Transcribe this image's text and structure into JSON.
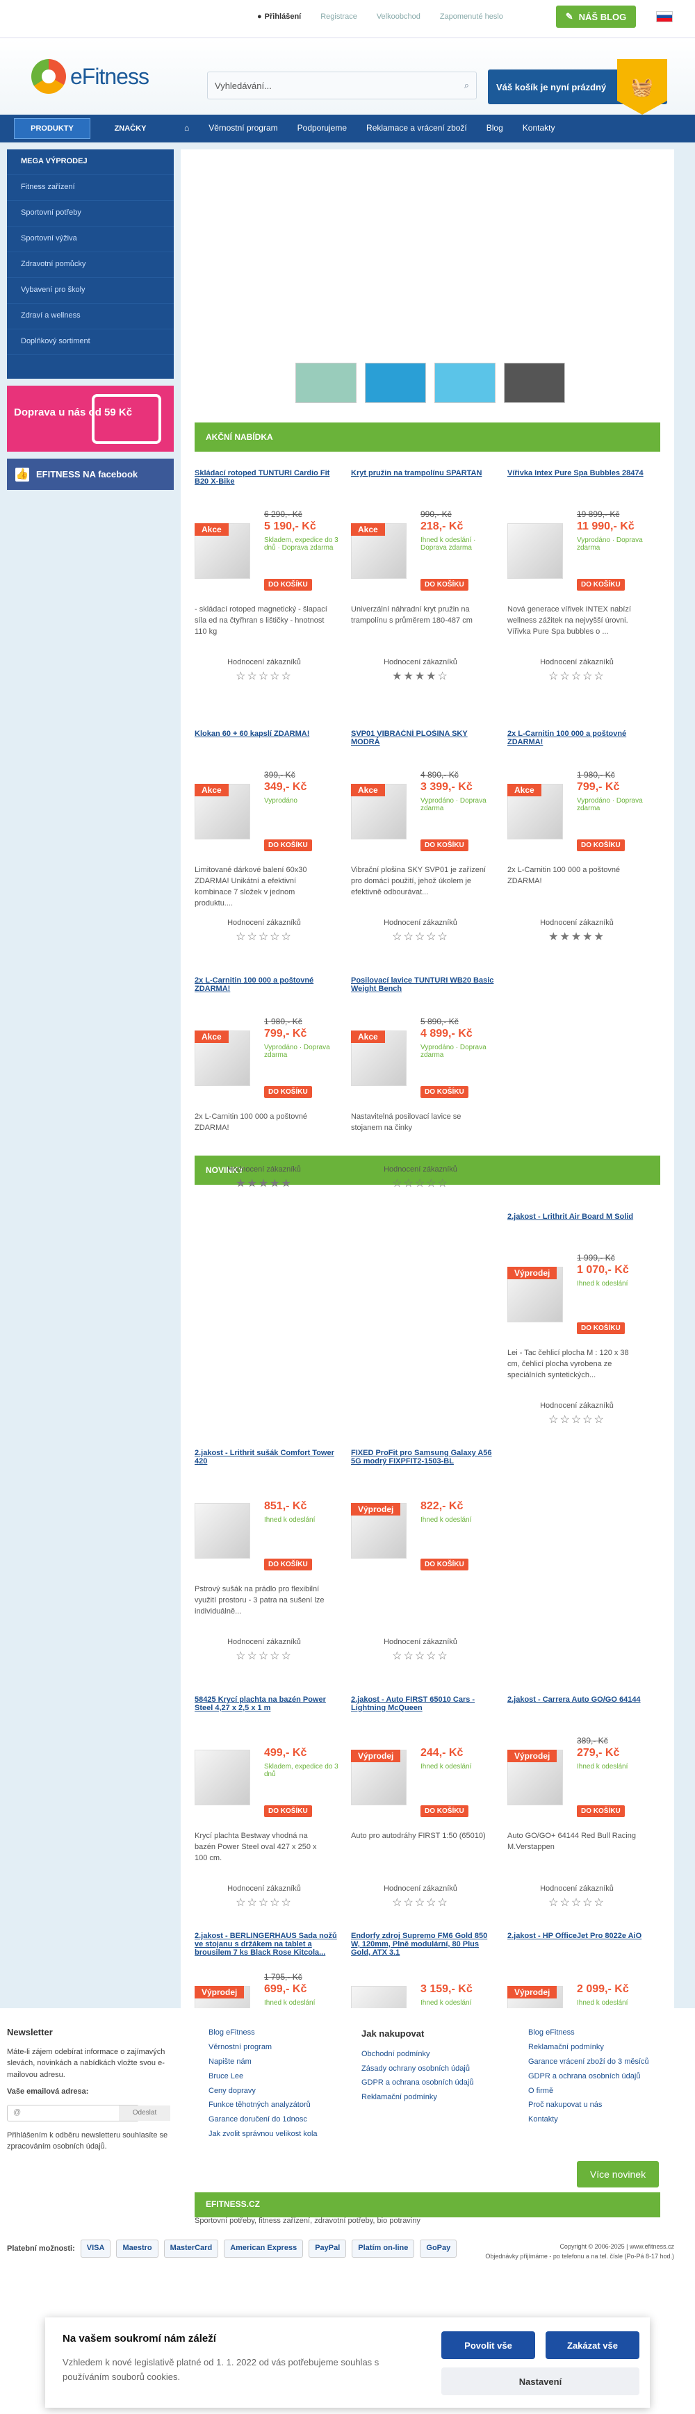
{
  "top": {
    "login": "Přihlášení",
    "register": "Registrace",
    "wholesale": "Velkoobchod",
    "forgot": "Zapomenuté heslo",
    "blog": "NÁŠ BLOG"
  },
  "header": {
    "logo": "eFitness",
    "search_placeholder": "Vyhledávání...",
    "cart": "Váš košík je nyní prázdný"
  },
  "nav": {
    "products": "PRODUKTY",
    "brands": "ZNAČKY",
    "links": [
      "Věrnostní program",
      "Podporujeme",
      "Reklamace a vrácení zboží",
      "Blog",
      "Kontakty"
    ]
  },
  "sidebar": [
    "MEGA VÝPRODEJ",
    "Fitness zařízení",
    "Sportovní potřeby",
    "Sportovní výživa",
    "Zdravotní pomůcky",
    "Vybavení pro školy",
    "Zdraví a wellness",
    "Doplňkový sortiment"
  ],
  "doprava": "Doprava u nás od 59 Kč",
  "facebook": "EFITNESS NA facebook",
  "sections": {
    "akce": "AKČNÍ NABÍDKA",
    "novinky": "NOVINKY"
  },
  "rating_label": "Hodnocení zákazníků",
  "buy_label": "DO KOŠÍKU",
  "products": [
    {
      "title": "Skládací rotoped TUNTURI Cardio Fit B20 X-Bike",
      "tag": "Akce",
      "old": "6 290,- Kč",
      "new": "5 190,- Kč",
      "avail": "Skladem, expedice do 3 dnů · Doprava zdarma",
      "desc": "- skládací rotoped magnetický - šlapací síla ed na čtyřhran s lištičky - hnotnost 110 kg",
      "stars": "☆☆☆☆☆"
    },
    {
      "title": "Kryt pružin na trampolínu SPARTAN",
      "tag": "Akce",
      "old": "990,- Kč",
      "new": "218,- Kč",
      "avail": "Ihned k odeslání · Doprava zdarma",
      "desc": "Univerzální náhradní kryt pružin na trampolínu s průměrem 180-487 cm",
      "stars": "★★★★☆"
    },
    {
      "title": "Vířivka Intex Pure Spa Bubbles 28474",
      "tag": "",
      "old": "19 899,- Kč",
      "new": "11 990,- Kč",
      "avail": "Vyprodáno · Doprava zdarma",
      "desc": "Nová generace vířivek INTEX nabízí wellness zážitek na nejvyšší úrovni. Vířivka Pure Spa bubbles o ...",
      "stars": "☆☆☆☆☆"
    },
    {
      "title": "Klokan 60 + 60 kapslí ZDARMA!",
      "tag": "Akce",
      "old": "399,- Kč",
      "new": "349,- Kč",
      "avail": "Vyprodáno",
      "desc": "Limitované dárkové balení 60x30 ZDARMA! Unikátní a efektivní kombinace 7 složek v jednom produktu....",
      "stars": "☆☆☆☆☆"
    },
    {
      "title": "SVP01 VIBRAČNÍ PLOŠINA SKY MODRÁ",
      "tag": "Akce",
      "old": "4 890,- Kč",
      "new": "3 399,- Kč",
      "avail": "Vyprodáno · Doprava zdarma",
      "desc": "Vibrační plošina SKY SVP01 je zařízení pro domácí použití, jehož úkolem je efektivně odbourávat...",
      "stars": "☆☆☆☆☆"
    },
    {
      "title": "2x L-Carnitin 100 000 a poštovné ZDARMA!",
      "tag": "Akce",
      "old": "1 980,- Kč",
      "new": "799,- Kč",
      "avail": "Vyprodáno · Doprava zdarma",
      "desc": "2x L-Carnitin 100 000 a poštovné ZDARMA!",
      "stars": "★★★★★"
    },
    {
      "title": "2x L-Carnitin 100 000 a poštovné ZDARMA!",
      "tag": "Akce",
      "old": "1 980,- Kč",
      "new": "799,- Kč",
      "avail": "Vyprodáno · Doprava zdarma",
      "desc": "2x L-Carnitin 100 000 a poštovné ZDARMA!",
      "stars": "★★★★★"
    },
    {
      "title": "Posilovací lavice TUNTURI WB20 Basic Weight Bench",
      "tag": "Akce",
      "old": "5 890,- Kč",
      "new": "4 899,- Kč",
      "avail": "Vyprodáno · Doprava zdarma",
      "desc": "Nastavitelná posilovací lavice se stojanem na činky",
      "stars": "☆☆☆☆☆"
    },
    {
      "title": "2.jakost - Lrithrit Air Board M Solid",
      "tag": "Výprodej",
      "old": "1 999,- Kč",
      "new": "1 070,- Kč",
      "avail": "Ihned k odeslání",
      "desc": "Lei - Tac čehlicí plocha M : 120 x 38 cm, čehlicí plocha vyrobena ze speciálních syntetických...",
      "stars": "☆☆☆☆☆"
    },
    {
      "title": "2.jakost - Lrithrit sušák Comfort Tower 420",
      "tag": "",
      "old": "",
      "new": "851,- Kč",
      "avail": "Ihned k odeslání",
      "desc": "Pstrový sušák na prádlo pro flexibilní využití prostoru - 3 patra na sušení lze individuálně...",
      "stars": "☆☆☆☆☆"
    },
    {
      "title": "FIXED ProFit pro Samsung Galaxy A56 5G modrý FIXPFIT2-1503-BL",
      "tag": "Výprodej",
      "old": "",
      "new": "822,- Kč",
      "avail": "Ihned k odeslání",
      "desc": "",
      "stars": "☆☆☆☆☆"
    },
    {
      "title": "58425 Krycí plachta na bazén Power Steel 4,27 x 2,5 x 1 m",
      "tag": "",
      "old": "",
      "new": "499,- Kč",
      "avail": "Skladem, expedice do 3 dnů",
      "desc": "Krycí plachta Bestway vhodná na bazén Power Steel oval 427 x 250 x 100 cm.",
      "stars": "☆☆☆☆☆"
    },
    {
      "title": "2.jakost - Auto FIRST 65010 Cars - Lightning McQueen",
      "tag": "Výprodej",
      "old": "",
      "new": "244,- Kč",
      "avail": "Ihned k odeslání",
      "desc": "Auto pro autodráhy FIRST 1:50 (65010)",
      "stars": "☆☆☆☆☆"
    },
    {
      "title": "2.jakost - Carrera Auto GO/GO 64144",
      "tag": "Výprodej",
      "old": "389,- Kč",
      "new": "279,- Kč",
      "avail": "Ihned k odeslání",
      "desc": "Auto GO/GO+ 64144 Red Bull Racing M.Verstappen",
      "stars": "☆☆☆☆☆"
    },
    {
      "title": "2.jakost - BERLINGERHAUS Sada nožů ve stojanu s držákem na tablet a brousilem 7 ks Black Rose Kitcola...",
      "tag": "Výprodej",
      "old": "1 795,- Kč",
      "new": "699,- Kč",
      "avail": "Ihned k odeslání",
      "desc": "",
      "stars": "☆☆☆☆☆"
    },
    {
      "title": "Endorfy zdroj Supremo FM6 Gold 850 W, 120mm, Plně modulární, 80 Plus Gold, ATX 3.1",
      "tag": "",
      "old": "",
      "new": "3 159,- Kč",
      "avail": "Ihned k odeslání",
      "desc": "",
      "stars": "☆☆☆☆☆"
    },
    {
      "title": "2.jakost - HP OfficeJet Pro 8022e AiO",
      "tag": "Výprodej",
      "old": "",
      "new": "2 099,- Kč",
      "avail": "Ihned k odeslání",
      "desc": "",
      "stars": "☆☆☆☆☆"
    }
  ],
  "footer": {
    "news_title": "Newsletter",
    "news_text": "Máte-li zájem odebírat informace o zajímavých slevách, novinkách a nabídkách vložte svou e-mailovou adresu.",
    "email_label": "Vaše emailová adresa:",
    "email_btn": "Odeslat",
    "news_note": "Přihlášením k odběru newsletteru souhlasíte se zpracováním osobních údajů.",
    "col1": [
      "Blog eFitness",
      "Věrnostní program",
      "Napište nám",
      "Bruce Lee",
      "Ceny dopravy",
      "Funkce těhotných analyzátorů",
      "Garance doručení do 1dnosc",
      "Jak zvolit správnou velikost kola"
    ],
    "col2_title": "Jak nakupovat",
    "col2": [
      "Obchodní podmínky",
      "Zásady ochrany osobních údajů",
      "GDPR a ochrana osobních údajů",
      "Reklamační podmínky"
    ],
    "col3": [
      "Blog eFitness",
      "Reklamační podmínky",
      "Garance vrácení zboží do 3 měsíců",
      "GDPR a ochrana osobních údajů",
      "O firmě",
      "Proč nakupovat u nás",
      "Kontakty"
    ],
    "bar": "EFITNESS.CZ",
    "sub": "Sportovní potřeby, fitness zařízení, zdravotní potřeby, bio potraviny",
    "pay_label": "Platební možnosti:",
    "pay": [
      "VISA",
      "Maestro",
      "MasterCard",
      "American Express",
      "PayPal",
      "Platím on-line",
      "GoPay"
    ],
    "copyright": "Copyright © 2006-2025 | www.efitness.cz",
    "copy2": "Objednávky přijímáme - po telefonu a na tel. čísle (Po-Pá 8-17 hod.)",
    "novinky_btn": "Více novinek"
  },
  "cookie": {
    "title": "Na vašem soukromí nám záleží",
    "text": "Vzhledem k nové legislativě platné od 1. 1. 2022 od vás potřebujeme souhlas s používáním souborů cookies.",
    "allow_all": "Povolit vše",
    "reject": "Zakázat vše",
    "settings": "Nastavení"
  }
}
